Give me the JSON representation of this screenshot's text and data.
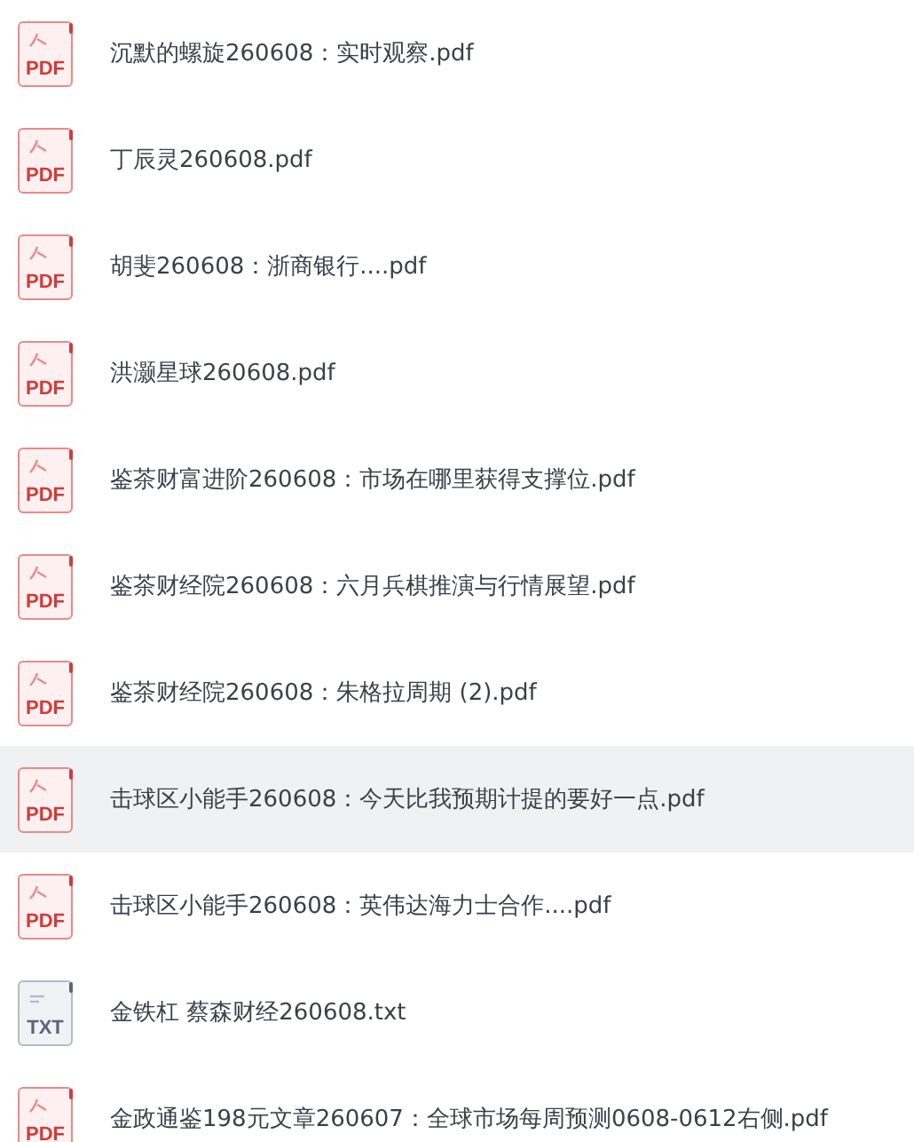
{
  "files": [
    {
      "kind": "pdf",
      "badge": "PDF",
      "name": "沉默的螺旋260608：实时观察.pdf",
      "selected": false
    },
    {
      "kind": "pdf",
      "badge": "PDF",
      "name": "丁辰灵260608.pdf",
      "selected": false
    },
    {
      "kind": "pdf",
      "badge": "PDF",
      "name": "胡斐260608：浙商银行....pdf",
      "selected": false
    },
    {
      "kind": "pdf",
      "badge": "PDF",
      "name": "洪灏星球260608.pdf",
      "selected": false
    },
    {
      "kind": "pdf",
      "badge": "PDF",
      "name": "鉴茶财富进阶260608：市场在哪里获得支撑位.pdf",
      "selected": false
    },
    {
      "kind": "pdf",
      "badge": "PDF",
      "name": "鉴茶财经院260608：六月兵棋推演与行情展望.pdf",
      "selected": false
    },
    {
      "kind": "pdf",
      "badge": "PDF",
      "name": "鉴茶财经院260608：朱格拉周期 (2).pdf",
      "selected": false
    },
    {
      "kind": "pdf",
      "badge": "PDF",
      "name": "击球区小能手260608：今天比我预期计提的要好一点.pdf",
      "selected": true
    },
    {
      "kind": "pdf",
      "badge": "PDF",
      "name": "击球区小能手260608：英伟达海力士合作....pdf",
      "selected": false
    },
    {
      "kind": "txt",
      "badge": "TXT",
      "name": "金铁杠 蔡森财经260608.txt",
      "selected": false
    },
    {
      "kind": "pdf",
      "badge": "PDF",
      "name": "金政通鉴198元文章260607：全球市场每周预测0608-0612右侧.pdf",
      "selected": false
    }
  ]
}
